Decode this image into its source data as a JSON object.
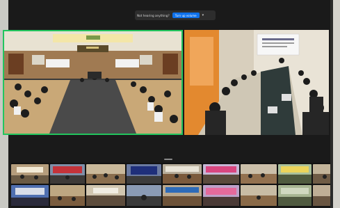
{
  "notification": {
    "message": "Not hearing anything?",
    "button_label": "Turn up volume",
    "more_icon": "chevron-down-icon"
  },
  "colors": {
    "active_speaker_border": "#22c55e",
    "banner_button": "#0e71eb",
    "background": "#1a1a1a"
  },
  "videos": {
    "main_left": {
      "description_icon": "video-tile",
      "active": true
    },
    "main_right": {
      "description_icon": "video-tile",
      "active": false
    }
  },
  "gallery": {
    "rows": 2,
    "columns": 8
  }
}
